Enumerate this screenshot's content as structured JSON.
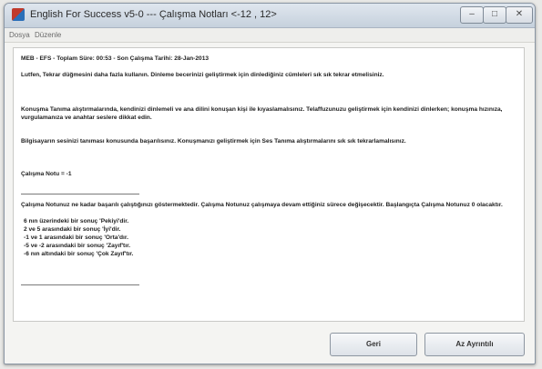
{
  "window": {
    "title": "English For Success v5-0  ---  Çalışma Notları <-12 , 12>",
    "controls": {
      "minimize": "–",
      "maximize": "□",
      "close": "✕"
    }
  },
  "menu": [
    "Dosya",
    "Düzenle"
  ],
  "info_line": "MEB  -  EFS  -  Toplam Süre: 00:53  -  Son Çalışma Tarihi: 28-Jan-2013",
  "paragraphs": [
    "Lutfen, Tekrar düğmesini daha fazla kullanın.  Dinleme becerinizi geliştirmek için dinlediğiniz cümleleri sık sık tekrar etmelisiniz.",
    "Konuşma Tanıma alıştırmalarında, kendinizi dinlemeli ve ana dilini konuşan kişi ile kıyaslamalısınız.  Telaffuzunuzu geliştirmek için kendinizi dinlerken; konuşma hızınıza, vurgulamanıza ve anahtar seslere dikkat edin.",
    "Bilgisayarın sesinizi tanıması konusunda başarılısınız.  Konuşmanızı geliştirmek için Ses Tanıma alıştırmalarını sık sık tekrarlamalısınız."
  ],
  "score_line": "Çalışma Notu = -1",
  "explanation": "Çalışma Notunuz ne kadar başarılı çalıştığınızı göstermektedir.  Çalışma Notunuz çalışmaya devam ettiğiniz sürece değişecektir.  Başlangıçta Çalışma Notunuz  0  olacaktır.",
  "score_ranges": [
    "6 nın üzerindeki bir sonuç 'Pekiyi'dir.",
    "2 ve 5 arasındaki bir sonuç 'İyi'dir.",
    "-1 ve 1 arasındaki bir sonuç 'Orta'dır.",
    "-5 ve -2 arasındaki bir sonuç 'Zayıf'tır.",
    "-6 nın altındaki bir sonuç 'Çok Zayıf'tır."
  ],
  "buttons": {
    "back": "Geri",
    "less_detail": "Az Ayrıntılı"
  }
}
